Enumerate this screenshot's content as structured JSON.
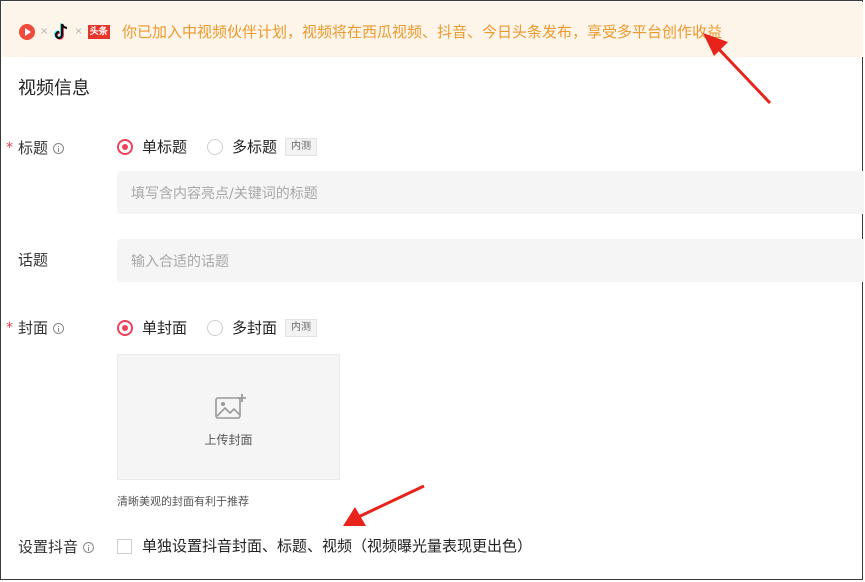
{
  "banner": {
    "platform_sep": "×",
    "toutiao_logo_text": "头条",
    "text": "你已加入中视频伙伴计划，视频将在西瓜视频、抖音、今日头条发布，享受多平台创作收益",
    "text_color": "#ec9a2c",
    "background": "#fdf4ea"
  },
  "section": {
    "title": "视频信息"
  },
  "title_field": {
    "label": "标题",
    "required_mark": "*",
    "options": [
      {
        "label": "单标题",
        "selected": true
      },
      {
        "label": "多标题",
        "selected": false
      }
    ],
    "beta_badge": "内测",
    "placeholder": "填写含内容亮点/关键词的标题"
  },
  "topic_field": {
    "label": "话题",
    "placeholder": "输入合适的话题"
  },
  "cover_field": {
    "label": "封面",
    "required_mark": "*",
    "options": [
      {
        "label": "单封面",
        "selected": true
      },
      {
        "label": "多封面",
        "selected": false
      }
    ],
    "beta_badge": "内测",
    "upload_label": "上传封面",
    "hint": "清晰美观的封面有利于推荐"
  },
  "douyin_setting": {
    "label": "设置抖音",
    "checkbox_label": "单独设置抖音封面、标题、视频（视频曝光量表现更出色）",
    "checked": false
  },
  "colors": {
    "accent": "#f0405a",
    "annotation_arrow": "#e8231b"
  }
}
